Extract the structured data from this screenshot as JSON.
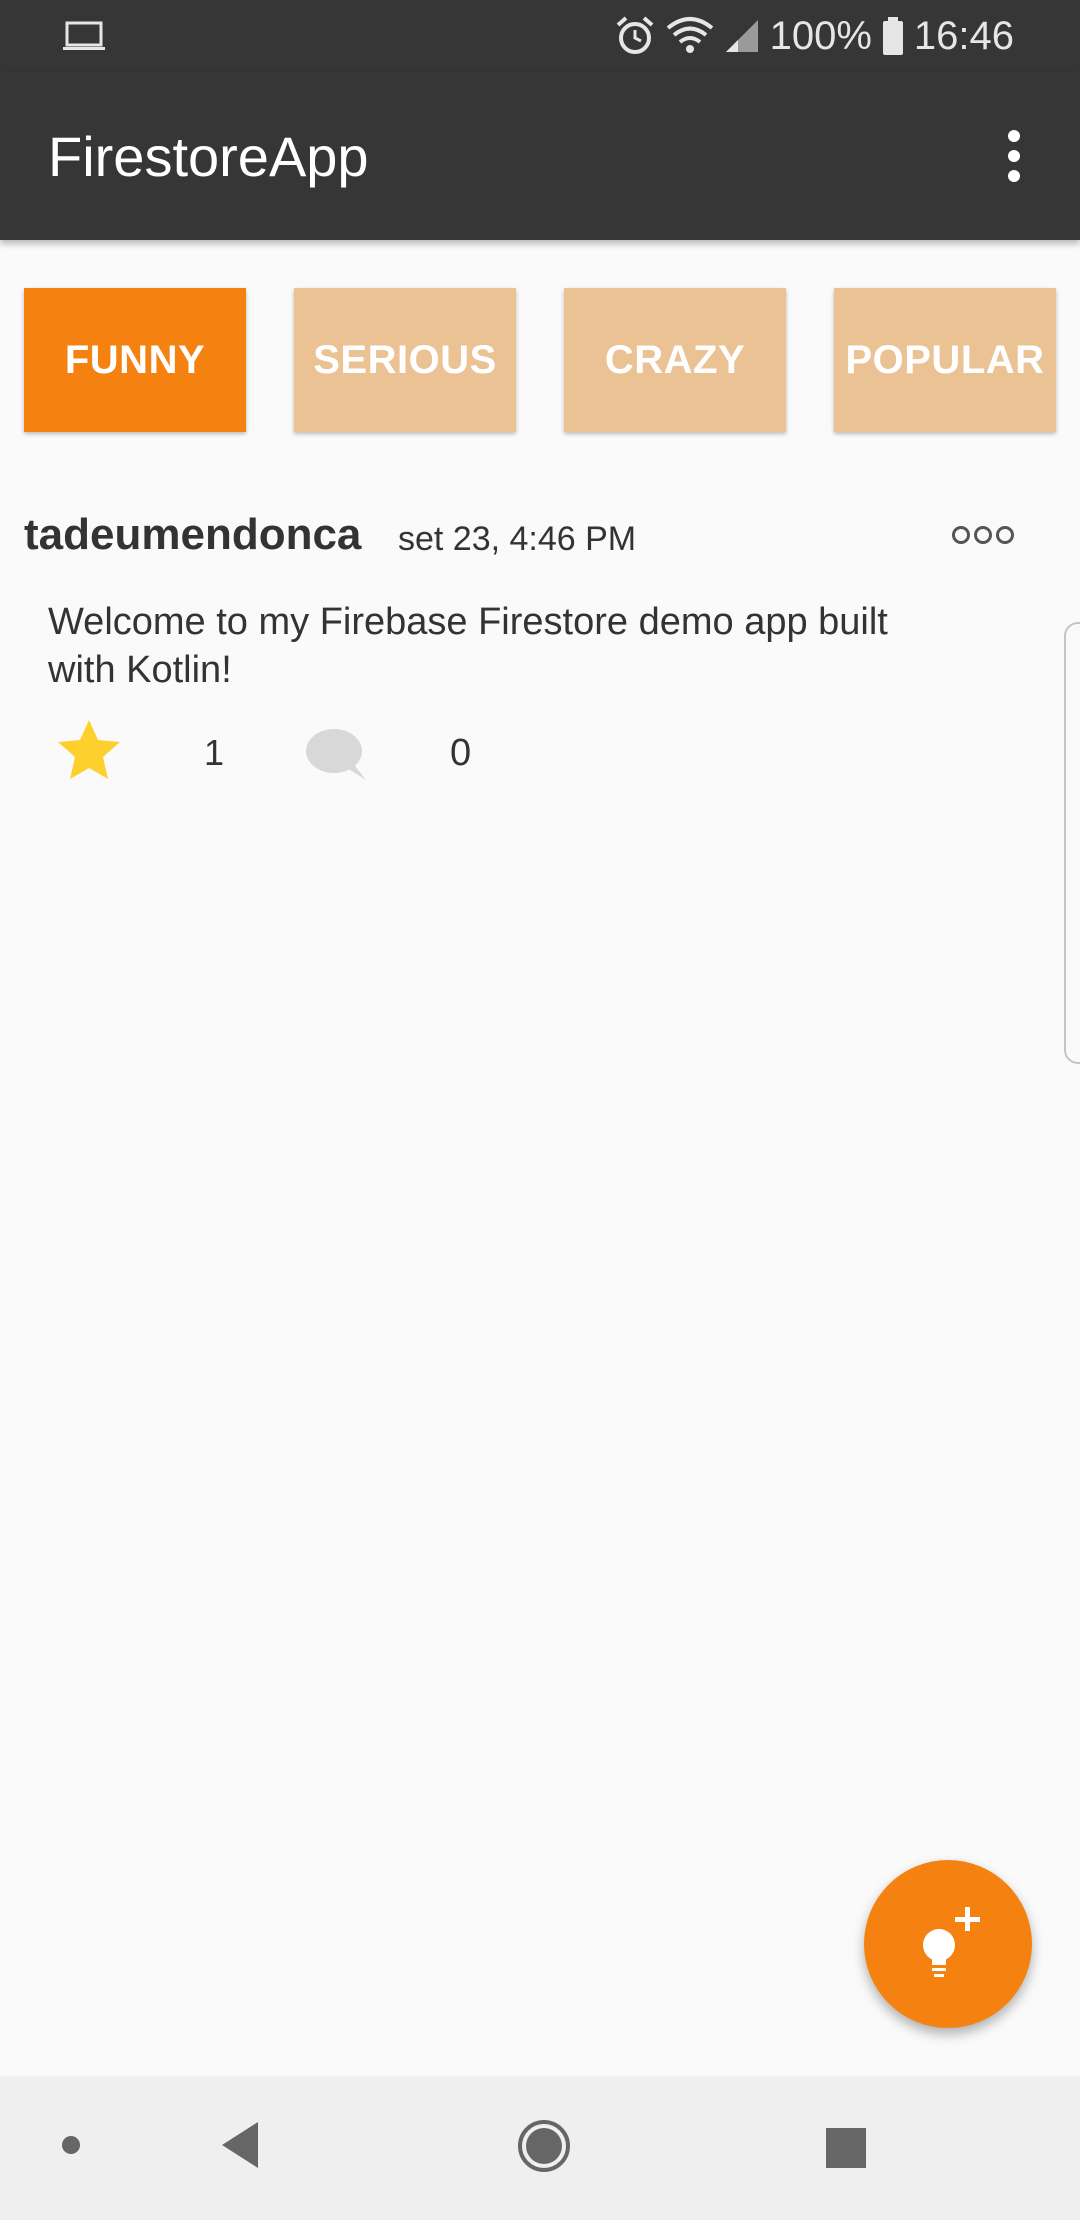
{
  "status_bar": {
    "battery": "100%",
    "time": "16:46",
    "icons": [
      "laptop-icon",
      "alarm-icon",
      "wifi-icon",
      "signal-icon",
      "battery-icon"
    ]
  },
  "app_bar": {
    "title": "FirestoreApp",
    "overflow_icon": "more-vert-icon"
  },
  "tabs": [
    {
      "label": "FUNNY",
      "active": true
    },
    {
      "label": "SERIOUS",
      "active": false
    },
    {
      "label": "CRAZY",
      "active": false
    },
    {
      "label": "POPULAR",
      "active": false
    }
  ],
  "post": {
    "username": "tadeumendonca",
    "date": "set 23, 4:46 PM",
    "text": "Welcome to my Firebase Firestore demo app built with Kotlin!",
    "stars": "1",
    "comments": "0"
  },
  "fab": {
    "icon": "lightbulb-add-icon"
  },
  "colors": {
    "app_bar": "#363636",
    "accent": "#f58210",
    "tab_inactive": "#ebc294",
    "star": "#fdd02e",
    "background": "#fafafa"
  }
}
